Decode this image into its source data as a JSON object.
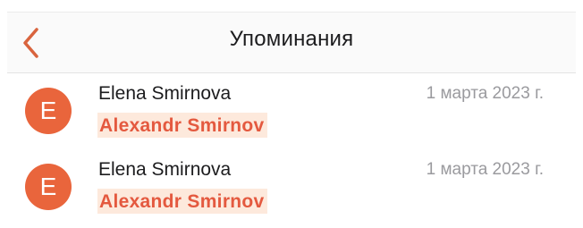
{
  "header": {
    "title": "Упоминания",
    "back_icon": "chevron-left-icon",
    "accent_color": "#d9643e"
  },
  "mentions": [
    {
      "avatar_letter": "E",
      "author": "Elena Smirnova",
      "date": "1 марта 2023 г.",
      "mentioned_user": "Alexandr Smirnov"
    },
    {
      "avatar_letter": "E",
      "author": "Elena Smirnova",
      "date": "1 марта 2023 г.",
      "mentioned_user": "Alexandr Smirnov"
    }
  ],
  "colors": {
    "avatar": "#e9653c",
    "mention_text": "#e4593f",
    "mention_background": "#fde9dc",
    "date_text": "#9a9a9e"
  }
}
